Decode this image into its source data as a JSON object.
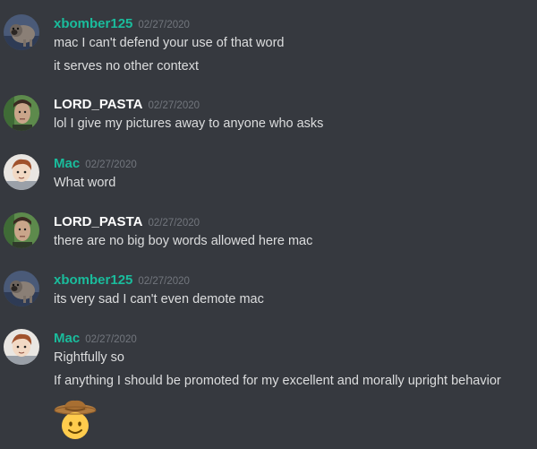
{
  "colors": {
    "background": "#36393f",
    "teal_name": "#1abc9c",
    "white_name": "#ffffff",
    "message_text": "#dcddde",
    "timestamp": "#72767d"
  },
  "messages": [
    {
      "username": "xbomber125",
      "timestamp": "02/27/2020",
      "avatar": "pug-avatar",
      "lines": [
        "mac I can't defend your use of that word",
        "it serves no other context"
      ]
    },
    {
      "username": "LORD_PASTA",
      "timestamp": "02/27/2020",
      "avatar": "photo-avatar",
      "lines": [
        "lol I give my pictures away to anyone who asks"
      ]
    },
    {
      "username": "Mac",
      "timestamp": "02/27/2020",
      "avatar": "cartoon-avatar",
      "lines": [
        "What word"
      ]
    },
    {
      "username": "LORD_PASTA",
      "timestamp": "02/27/2020",
      "avatar": "photo-avatar",
      "lines": [
        "there are no big boy words allowed here mac"
      ]
    },
    {
      "username": "xbomber125",
      "timestamp": "02/27/2020",
      "avatar": "pug-avatar",
      "lines": [
        "its very sad I can't even demote mac"
      ]
    },
    {
      "username": "Mac",
      "timestamp": "02/27/2020",
      "avatar": "cartoon-avatar",
      "lines": [
        "Rightfully so",
        "If anything I should be promoted for my excellent and morally upright behavior"
      ],
      "emoji": "cowboy-hat-face-emoji"
    }
  ]
}
